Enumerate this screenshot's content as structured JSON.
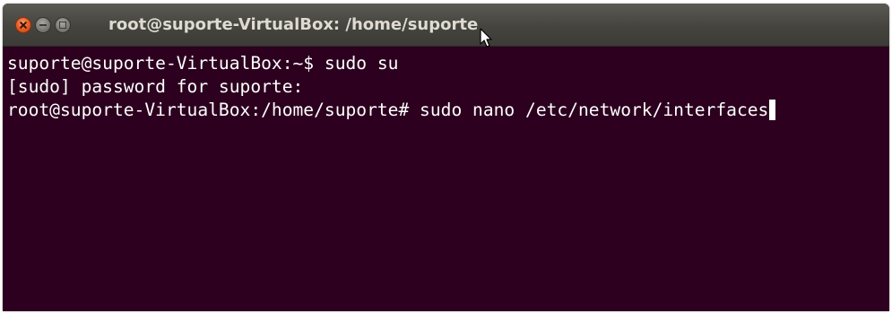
{
  "window": {
    "title": "root@suporte-VirtualBox: /home/suporte",
    "controls": [
      "close-icon",
      "minimize-icon",
      "maximize-icon"
    ]
  },
  "terminal": {
    "lines": [
      "suporte@suporte-VirtualBox:~$ sudo su",
      "[sudo] password for suporte:",
      "root@suporte-VirtualBox:/home/suporte# sudo nano /etc/network/interfaces"
    ],
    "background_color": "#2c001e",
    "text_color": "#ffffff"
  },
  "titlebar": {
    "close_color": "#e8622a",
    "text_color": "#dfdbd2"
  }
}
